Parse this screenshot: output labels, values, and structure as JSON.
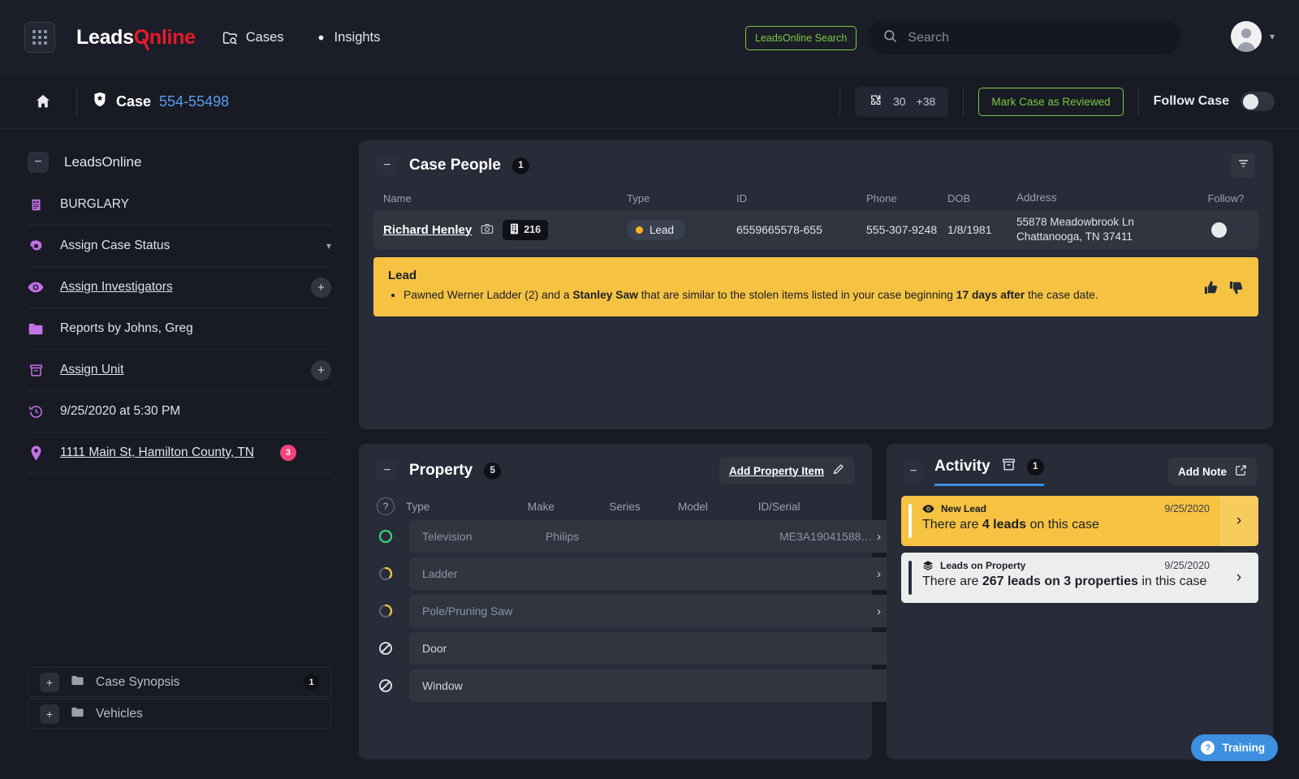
{
  "header": {
    "apps_icon": "grid-icon",
    "brand": {
      "part1": "Leads",
      "part2": "Online"
    },
    "nav": [
      {
        "label": "Cases",
        "icon": "folder-search-icon"
      },
      {
        "label": "Insights",
        "icon": "insights-icon"
      }
    ],
    "leadsonline_search_label": "LeadsOnline Search",
    "search_placeholder": "Search",
    "search_value": "",
    "search_icon": "search-icon",
    "avatar_icon": "user-avatar-icon",
    "caret_icon": "chevron-down-icon",
    "accent_green": "#7ac943",
    "brand_red": "#e8192c"
  },
  "casebar": {
    "home_icon": "home-icon",
    "shield_icon": "police-badge-icon",
    "case_label": "Case",
    "case_number": "554-55498",
    "score_icon": "puzzle-icon",
    "score_value": "30",
    "score_delta": "+38",
    "review_button": "Mark Case as Reviewed",
    "follow_label": "Follow Case",
    "follow_on": true
  },
  "sidebar": {
    "title": "LeadsOnline",
    "collapse_icon": "minus-icon",
    "items": [
      {
        "label": "BURGLARY",
        "icon": "report-icon",
        "link": false,
        "action": "none"
      },
      {
        "label": "Assign Case Status",
        "icon": "gear-icon",
        "link": false,
        "action": "chevron"
      },
      {
        "label": "Assign Investigators",
        "icon": "eye-icon",
        "link": true,
        "action": "plus"
      },
      {
        "label": "Reports by Johns, Greg",
        "icon": "folder-icon",
        "link": false,
        "action": "none"
      },
      {
        "label": "Assign Unit",
        "icon": "archive-icon",
        "link": true,
        "action": "plus"
      },
      {
        "label": "9/25/2020 at 5:30 PM",
        "icon": "history-icon",
        "link": false,
        "action": "none"
      },
      {
        "label": "1111 Main St, Hamilton County, TN",
        "icon": "location-pin-icon",
        "link": true,
        "action": "none",
        "badge": "3"
      }
    ],
    "folders": [
      {
        "label": "Case Synopsis",
        "icon": "folder-icon",
        "expand_icon": "plus-icon",
        "count": "1"
      },
      {
        "label": "Vehicles",
        "icon": "folder-icon",
        "expand_icon": "plus-icon",
        "count": ""
      }
    ]
  },
  "case_people": {
    "title": "Case People",
    "count": "1",
    "collapse_icon": "minus-icon",
    "filter_icon": "filter-icon",
    "columns": [
      "Name",
      "Type",
      "ID",
      "Phone",
      "DOB",
      "Address",
      "Follow?"
    ],
    "rows": [
      {
        "name": "Richard Henley",
        "camera_icon": "camera-icon",
        "pawn_icon": "pawn-ticket-icon",
        "pawn_count": "216",
        "type": "Lead",
        "id": "6559665578-655",
        "phone": "555-307-9248",
        "dob": "1/8/1981",
        "address_line1": "55878 Meadowbrook Ln",
        "address_line2": "Chattanooga, TN 37411",
        "follow_on": true
      }
    ],
    "lead_banner": {
      "title": "Lead",
      "bullet_prefix": "Pawned Werner Ladder (2) and a ",
      "bullet_bold1": "Stanley Saw",
      "bullet_mid": " that are similar to the stolen items listed in your case beginning ",
      "bullet_bold2": "17 days after",
      "bullet_suffix": " the case date.",
      "thumbs_up_icon": "thumbs-up-icon",
      "thumbs_down_icon": "thumbs-down-icon",
      "color": "#f5c242"
    }
  },
  "property": {
    "title": "Property",
    "count": "5",
    "collapse_icon": "minus-icon",
    "add_label": "Add Property Item",
    "add_icon": "pencil-icon",
    "help_icon": "question-icon",
    "columns": [
      "Type",
      "Make",
      "Series",
      "Model",
      "ID/Serial"
    ],
    "rows": [
      {
        "status": "complete",
        "status_icon": "ring-complete-icon",
        "type": "Television",
        "make": "Philips",
        "series": "",
        "model": "",
        "idserial": "ME3A19041588…",
        "chevron": true,
        "dim": true
      },
      {
        "status": "partial",
        "status_icon": "ring-partial-icon",
        "type": "Ladder",
        "make": "",
        "series": "",
        "model": "",
        "idserial": "",
        "chevron": true,
        "dim": true
      },
      {
        "status": "partial",
        "status_icon": "ring-partial-icon",
        "type": "Pole/Pruning Saw",
        "make": "",
        "series": "",
        "model": "",
        "idserial": "",
        "chevron": true,
        "dim": true
      },
      {
        "status": "none",
        "status_icon": "no-entry-icon",
        "type": "Door",
        "make": "",
        "series": "",
        "model": "",
        "idserial": "",
        "chevron": false,
        "dim": false
      },
      {
        "status": "none",
        "status_icon": "no-entry-icon",
        "type": "Window",
        "make": "",
        "series": "",
        "model": "",
        "idserial": "",
        "chevron": false,
        "dim": false
      }
    ]
  },
  "activity": {
    "title": "Activity",
    "archive_icon": "archive-icon",
    "count": "1",
    "collapse_icon": "minus-icon",
    "add_note_label": "Add Note",
    "add_note_icon": "note-edit-icon",
    "cards": [
      {
        "kind": "New Lead",
        "kind_icon": "eye-icon",
        "date": "9/25/2020",
        "text_prefix": "There are ",
        "text_bold": "4 leads",
        "text_suffix": " on this case",
        "style": "yellow",
        "arrow_icon": "chevron-right-icon"
      },
      {
        "kind": "Leads on Property",
        "kind_icon": "layers-icon",
        "date": "9/25/2020",
        "text_prefix": "There are ",
        "text_bold": "267 leads on 3 properties",
        "text_suffix": " in this case",
        "style": "white",
        "arrow_icon": "chevron-right-icon"
      }
    ]
  },
  "training": {
    "label": "Training",
    "icon": "question-circle-icon",
    "color": "#3d8fe0"
  }
}
